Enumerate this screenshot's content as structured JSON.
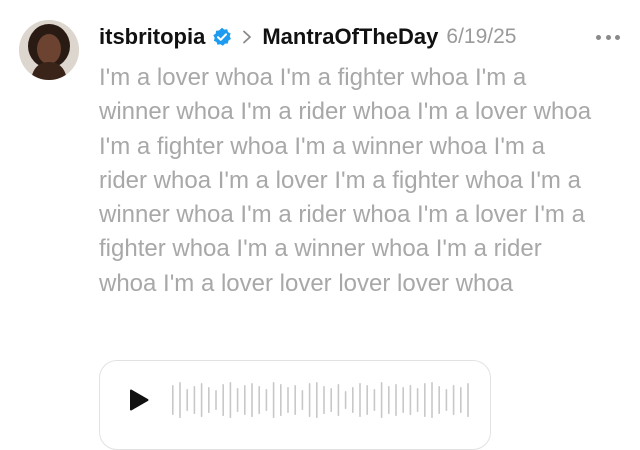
{
  "post": {
    "author": {
      "username": "itsbritopia",
      "verified": true
    },
    "community": "MantraOfTheDay",
    "date": "6/19/25",
    "body": "I'm a lover whoa I'm a fighter whoa I'm a winner whoa I'm a rider whoa I'm a lover whoa I'm a fighter whoa I'm a winner whoa I'm a rider whoa I'm a lover I'm a fighter whoa I'm a winner whoa I'm a rider whoa I'm a lover I'm a fighter whoa I'm a winner whoa I'm a rider whoa I'm a lover lover lover lover whoa"
  },
  "icons": {
    "verified": "verified-badge-icon",
    "separator": "chevron-right-icon",
    "more": "more-options-icon",
    "play": "play-icon",
    "waveform": "audio-waveform"
  },
  "colors": {
    "text_primary": "#111111",
    "text_muted": "#a8a8a8",
    "verified_blue": "#1d9bf0",
    "waveform": "#c8c8c8"
  }
}
